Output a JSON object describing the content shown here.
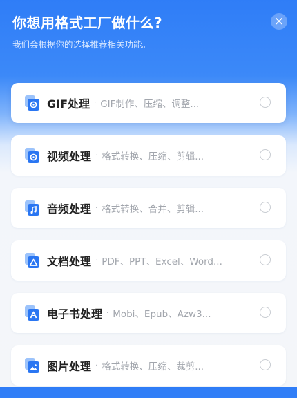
{
  "header": {
    "title": "你想用格式工厂做什么?",
    "subtitle": "我们会根据你的选择推荐相关功能。",
    "close_glyph": "×"
  },
  "separator": "·",
  "options": [
    {
      "name": "GIF处理",
      "desc": "GIF制作、压缩、调整...",
      "icon": "gif-icon",
      "selected": false
    },
    {
      "name": "视频处理",
      "desc": "格式转换、压缩、剪辑...",
      "icon": "video-icon",
      "selected": false
    },
    {
      "name": "音频处理",
      "desc": "格式转换、合并、剪辑...",
      "icon": "audio-icon",
      "selected": false
    },
    {
      "name": "文档处理",
      "desc": "PDF、PPT、Excel、Word...",
      "icon": "document-icon",
      "selected": false
    },
    {
      "name": "电子书处理",
      "desc": "Mobi、Epub、Azw3...",
      "icon": "ebook-icon",
      "selected": false
    },
    {
      "name": "图片处理",
      "desc": "格式转换、压缩、裁剪...",
      "icon": "image-icon",
      "selected": false
    }
  ],
  "colors": {
    "accent": "#2a76f2",
    "icon_back": "#9cc3fb"
  }
}
